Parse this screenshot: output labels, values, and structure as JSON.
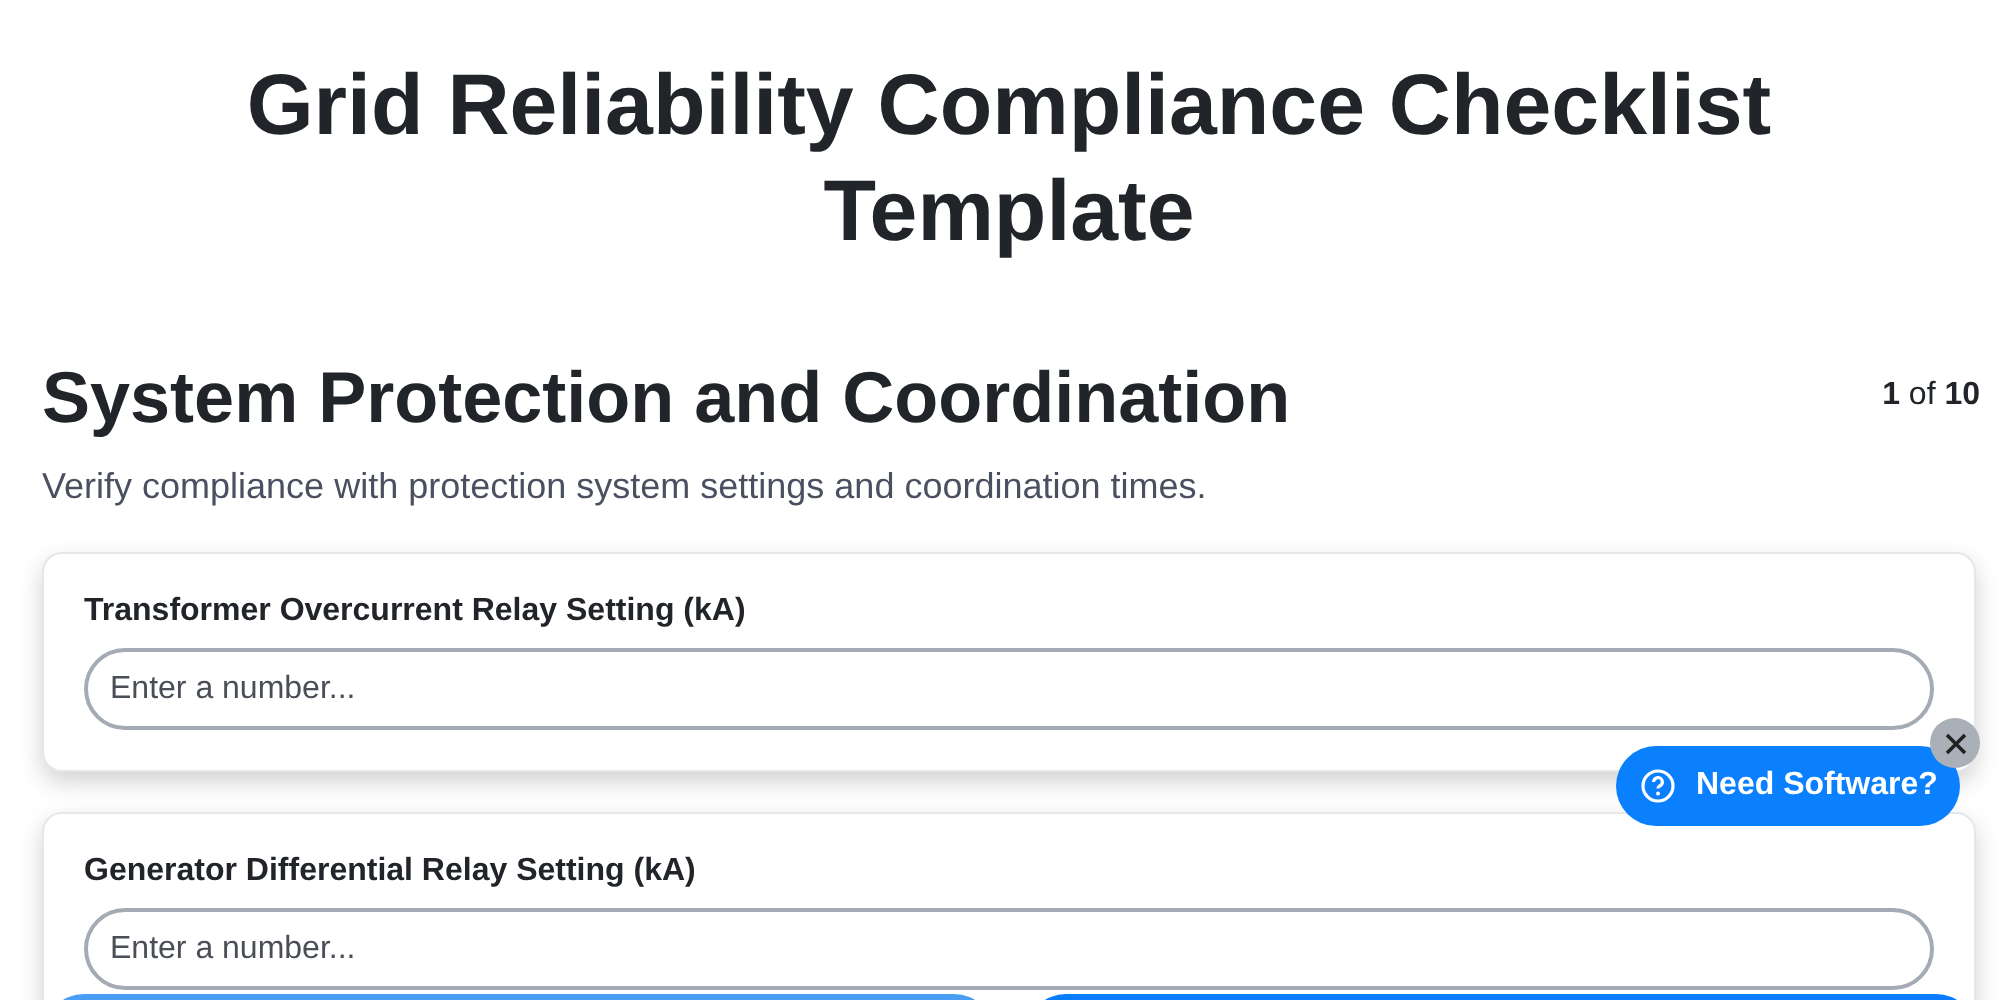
{
  "page_title": "Grid Reliability Compliance Checklist Template",
  "section": {
    "title": "System Protection and Coordination",
    "progress_current": "1",
    "progress_of": "of",
    "progress_total": "10",
    "description": "Verify compliance with protection system settings and coordination times."
  },
  "questions": [
    {
      "label": "Transformer Overcurrent Relay Setting (kA)",
      "placeholder": "Enter a number..."
    },
    {
      "label": "Generator Differential Relay Setting (kA)",
      "placeholder": "Enter a number..."
    }
  ],
  "help_widget": {
    "label": "Need Software?"
  },
  "footer_buttons": [
    {
      "kind": "secondary"
    },
    {
      "kind": "primary"
    }
  ]
}
